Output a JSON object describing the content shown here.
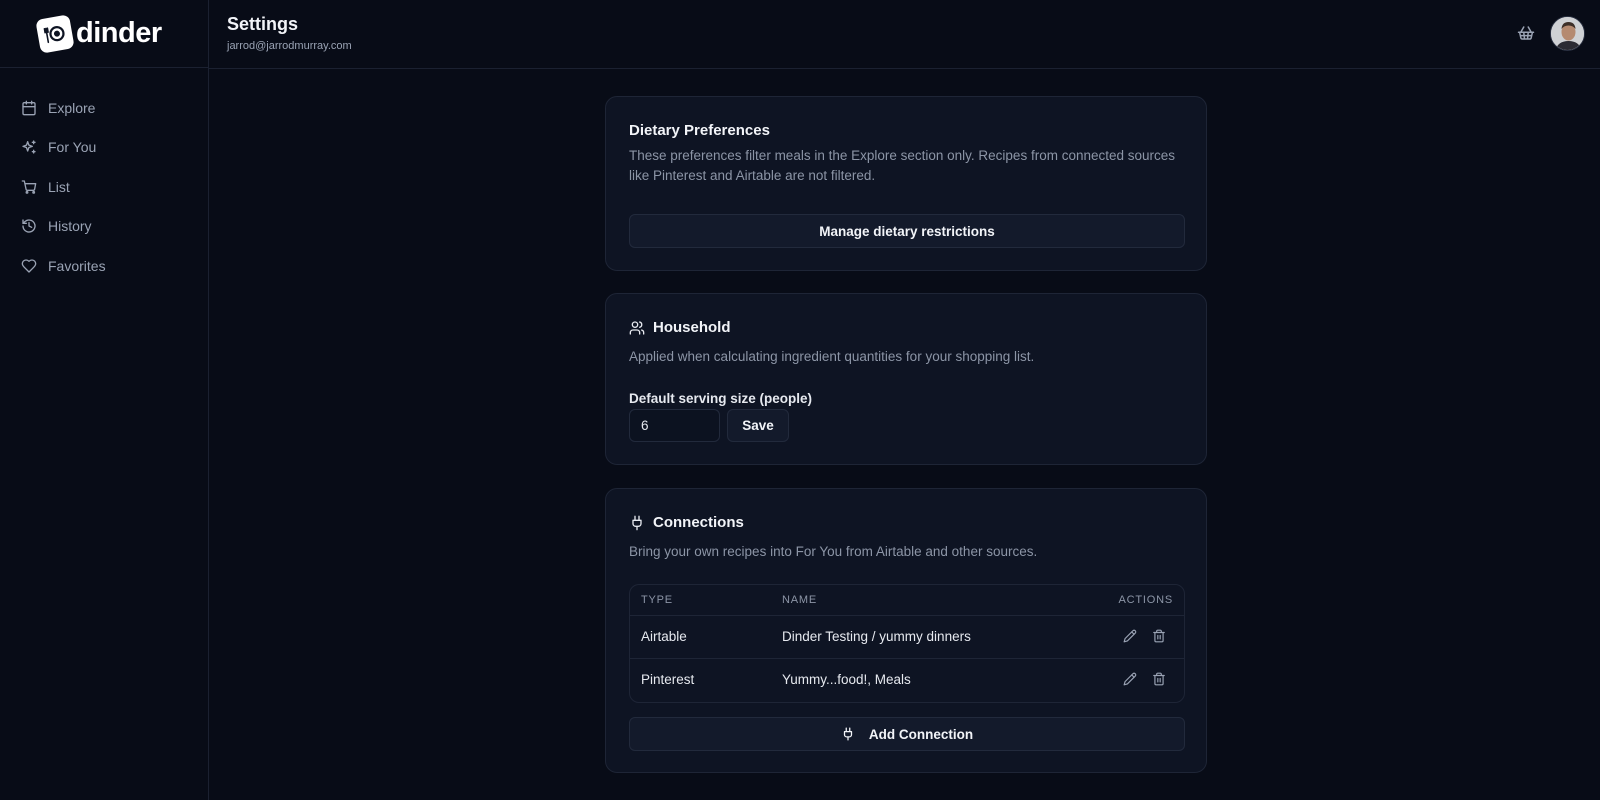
{
  "app": {
    "name": "dinder"
  },
  "sidebar": {
    "items": [
      {
        "label": "Explore",
        "icon": "calendar-icon"
      },
      {
        "label": "For You",
        "icon": "sparkles-icon"
      },
      {
        "label": "List",
        "icon": "cart-icon"
      },
      {
        "label": "History",
        "icon": "history-icon"
      },
      {
        "label": "Favorites",
        "icon": "heart-icon"
      }
    ]
  },
  "header": {
    "title": "Settings",
    "email": "jarrod@jarrodmurray.com"
  },
  "dietary": {
    "title": "Dietary Preferences",
    "description": "These preferences filter meals in the Explore section only. Recipes from connected sources like Pinterest and Airtable are not filtered.",
    "button_label": "Manage dietary restrictions"
  },
  "household": {
    "title": "Household",
    "description": "Applied when calculating ingredient quantities for your shopping list.",
    "field_label": "Default serving size (people)",
    "serving_size": "6",
    "save_label": "Save"
  },
  "connections": {
    "title": "Connections",
    "description": "Bring your own recipes into For You from Airtable and other sources.",
    "columns": {
      "type": "TYPE",
      "name": "NAME",
      "actions": "ACTIONS"
    },
    "rows": [
      {
        "type": "Airtable",
        "name": "Dinder Testing / yummy dinners"
      },
      {
        "type": "Pinterest",
        "name": "Yummy...food!, Meals"
      }
    ],
    "add_label": "Add Connection"
  },
  "colors": {
    "background": "#080c17",
    "card": "#0e1423",
    "border": "#1e2536",
    "muted_text": "#8c95a6"
  }
}
